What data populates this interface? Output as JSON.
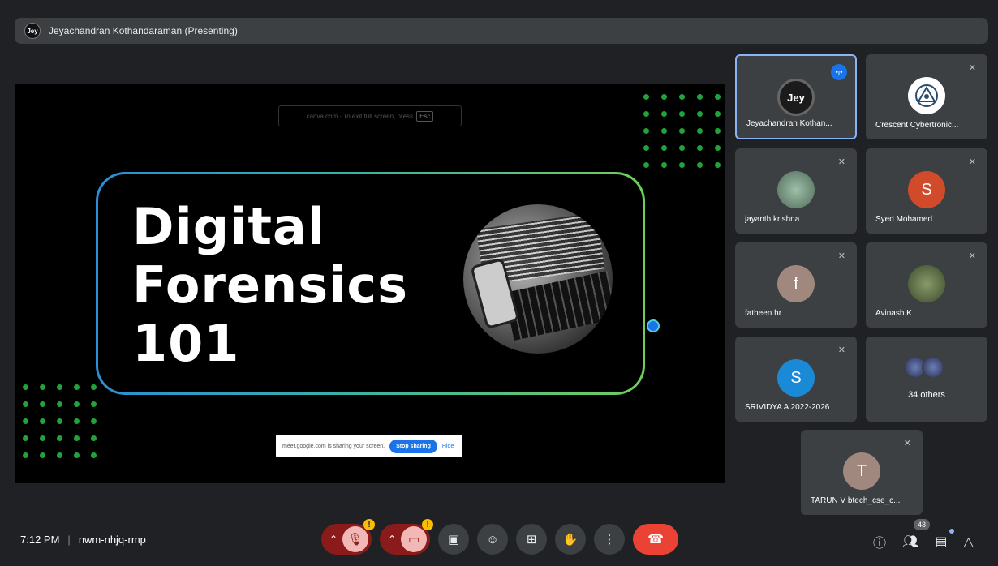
{
  "presenter": {
    "initials": "Jey",
    "label": "Jeyachandran Kothandaraman (Presenting)"
  },
  "slide": {
    "title_lines": [
      "Digital",
      "Forensics",
      "101"
    ],
    "fullscreen_hint": "canva.com · To exit full screen, press",
    "fullscreen_key": "Esc",
    "share_text": "meet.google.com is sharing your screen.",
    "stop_sharing": "Stop sharing",
    "hide": "Hide"
  },
  "participants": [
    {
      "name": "Jeyachandran Kothan...",
      "initials": "Jey",
      "avatar_color": "#1b1b1b",
      "speaking": true
    },
    {
      "name": "Crescent Cybertronic...",
      "initials": "",
      "avatar_color": "#ffffff",
      "muted": true
    },
    {
      "name": "jayanth krishna",
      "initials": "",
      "avatar_color": "#6b8f7a",
      "muted": true
    },
    {
      "name": "Syed Mohamed",
      "initials": "S",
      "avatar_color": "#d14b2a",
      "muted": true
    },
    {
      "name": "fatheen hr",
      "initials": "f",
      "avatar_color": "#a1887f",
      "muted": true
    },
    {
      "name": "Avinash K",
      "initials": "",
      "avatar_color": "#4e5b3a",
      "muted": true
    },
    {
      "name": "SRIVIDYA A 2022-2026",
      "initials": "S",
      "avatar_color": "#1a8ad6",
      "muted": true
    },
    {
      "name": "TARUN V btech_cse_c...",
      "initials": "T",
      "avatar_color": "#a1887f",
      "muted": true
    }
  ],
  "others": {
    "label": "34 others"
  },
  "meeting": {
    "time": "7:12 PM",
    "code": "nwm-nhjq-rmp"
  },
  "people_count": "43",
  "icons": {
    "mic": "mic-off-icon",
    "camera": "camera-off-icon",
    "captions": "captions-icon",
    "emoji": "emoji-icon",
    "present": "present-icon",
    "hand": "raise-hand-icon",
    "more": "more-icon",
    "end": "end-call-icon"
  }
}
